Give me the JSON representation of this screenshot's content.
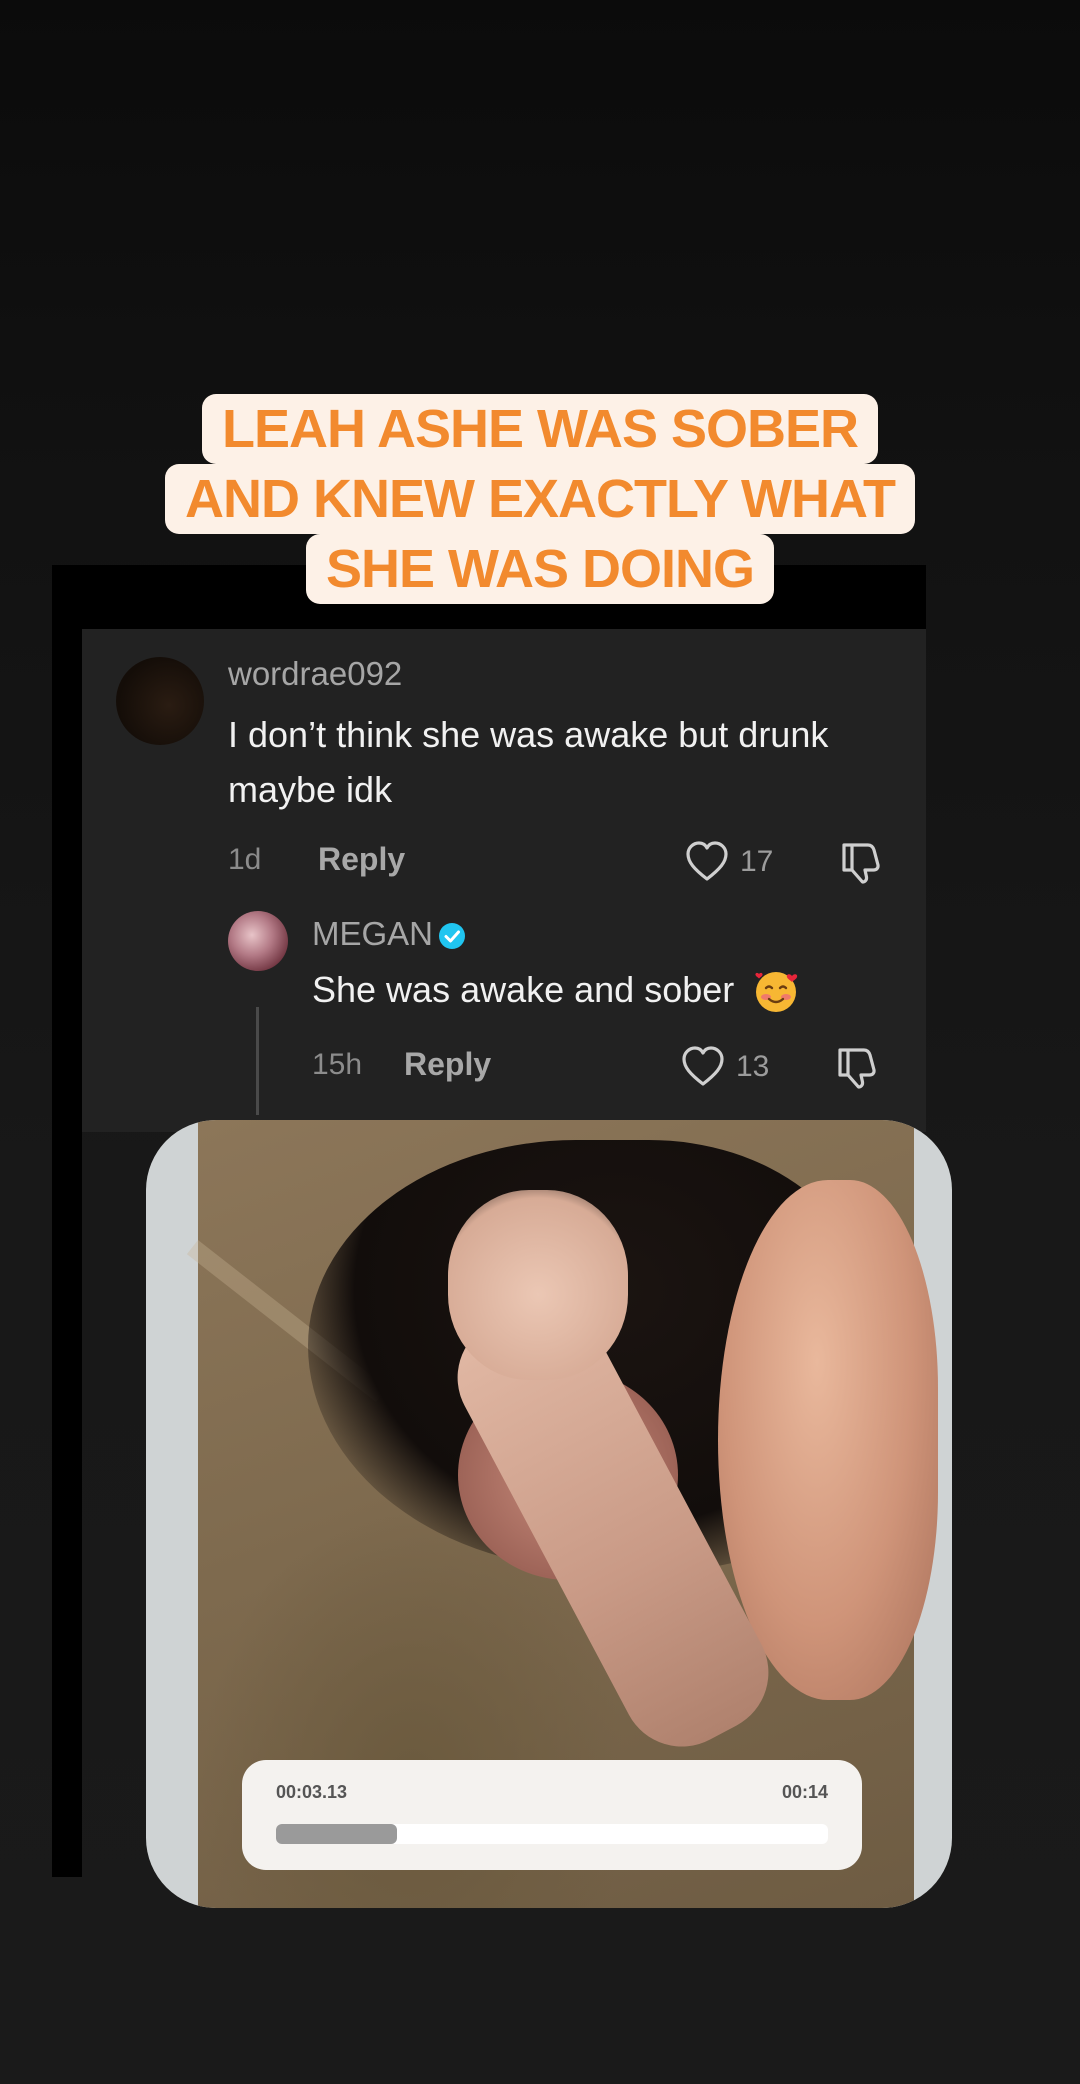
{
  "caption": {
    "lines": [
      "LEAH ASHE WAS SOBER",
      "AND KNEW EXACTLY WHAT",
      "SHE WAS DOING"
    ],
    "text_color": "#f28a2e",
    "background_color": "#fdf1e7"
  },
  "comment": {
    "username": "wordrae092",
    "text": "I don’t think she was awake but drunk maybe idk",
    "time": "1d",
    "reply_label": "Reply",
    "like_count": "17"
  },
  "reply": {
    "username": "MEGAN",
    "verified": true,
    "text": "She was awake and sober",
    "emoji": "smiling-face-with-hearts",
    "time": "15h",
    "reply_label": "Reply",
    "like_count": "13"
  },
  "media": {
    "player": {
      "elapsed": "00:03.13",
      "duration": "00:14",
      "progress_fraction": 0.22
    }
  },
  "colors": {
    "verified_badge": "#20c5f0",
    "card_background": "#222222"
  }
}
